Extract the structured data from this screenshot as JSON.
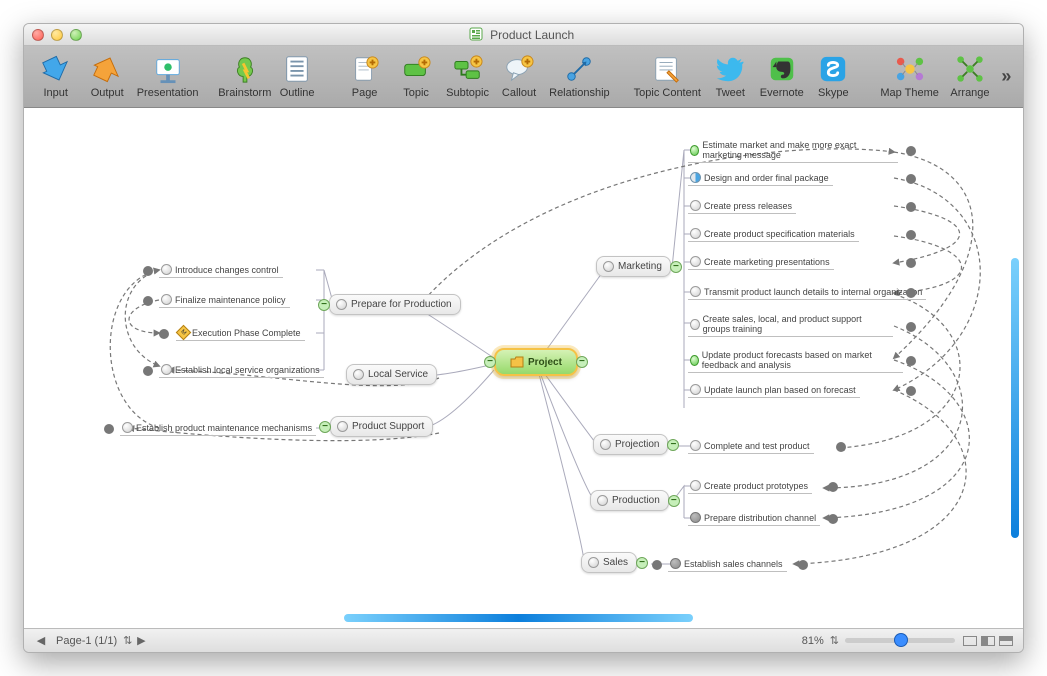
{
  "window": {
    "title": "Product Launch"
  },
  "toolbar": [
    {
      "id": "input",
      "label": "Input"
    },
    {
      "id": "output",
      "label": "Output"
    },
    {
      "id": "presentation",
      "label": "Presentation"
    },
    {
      "id": "brainstorm",
      "label": "Brainstorm"
    },
    {
      "id": "outline",
      "label": "Outline"
    },
    {
      "id": "page",
      "label": "Page"
    },
    {
      "id": "topic",
      "label": "Topic"
    },
    {
      "id": "subtopic",
      "label": "Subtopic"
    },
    {
      "id": "callout",
      "label": "Callout"
    },
    {
      "id": "relationship",
      "label": "Relationship"
    },
    {
      "id": "topic-content",
      "label": "Topic Content"
    },
    {
      "id": "tweet",
      "label": "Tweet"
    },
    {
      "id": "evernote",
      "label": "Evernote"
    },
    {
      "id": "skype",
      "label": "Skype"
    },
    {
      "id": "map-theme",
      "label": "Map Theme"
    },
    {
      "id": "arrange",
      "label": "Arrange"
    }
  ],
  "status": {
    "page": "Page-1 (1/1)",
    "zoom": "81%"
  },
  "map": {
    "root": "Project",
    "branches_right": [
      {
        "name": "Marketing",
        "children": [
          "Estimate market and make more exact marketing message",
          "Design and order final package",
          "Create press releases",
          "Create product specification materials",
          "Create marketing presentations",
          "Transmit product launch details to internal organization",
          "Create sales, local, and product support groups training",
          "Update product forecasts based on market feedback and analysis",
          "Update launch plan based on forecast"
        ]
      },
      {
        "name": "Projection",
        "children": [
          "Complete and test product"
        ]
      },
      {
        "name": "Production",
        "children": [
          "Create product prototypes",
          "Prepare distribution channel"
        ]
      },
      {
        "name": "Sales",
        "children": [
          "Establish sales channels"
        ]
      }
    ],
    "branches_left": [
      {
        "name": "Prepare for Production",
        "children": [
          "Introduce changes control",
          "Finalize maintenance policy",
          "Execution Phase Complete",
          "Establish local service organizations"
        ]
      },
      {
        "name": "Local Service",
        "children": []
      },
      {
        "name": "Product Support",
        "children": [
          "Establish product maintenance mechanisms"
        ]
      }
    ]
  }
}
